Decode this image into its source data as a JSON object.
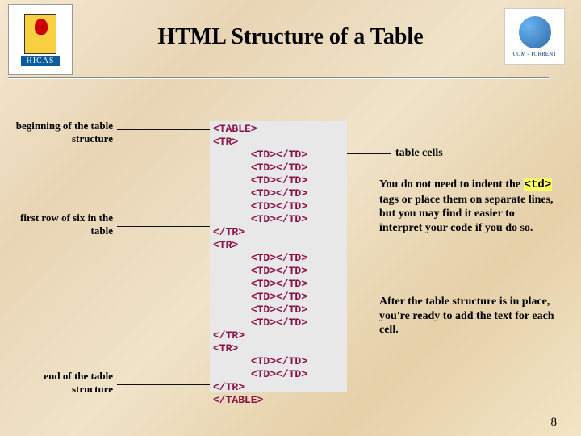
{
  "header": {
    "title": "HTML Structure of a Table",
    "left_logo_text": "HICAS",
    "right_logo_text": "COM - TORRENT"
  },
  "labels": {
    "beginning": "beginning of the table structure",
    "first_row": "first row of six in the table",
    "end": "end of the table structure",
    "cells": "table cells"
  },
  "code": {
    "lines": [
      {
        "t": "<TABLE>",
        "i": 0
      },
      {
        "t": "<TR>",
        "i": 0
      },
      {
        "t": "<TD></TD>",
        "i": 1
      },
      {
        "t": "<TD></TD>",
        "i": 1
      },
      {
        "t": "<TD></TD>",
        "i": 1
      },
      {
        "t": "<TD></TD>",
        "i": 1
      },
      {
        "t": "<TD></TD>",
        "i": 1
      },
      {
        "t": "<TD></TD>",
        "i": 1
      },
      {
        "t": "</TR>",
        "i": 0
      },
      {
        "t": "<TR>",
        "i": 0
      },
      {
        "t": "<TD></TD>",
        "i": 1
      },
      {
        "t": "<TD></TD>",
        "i": 1
      },
      {
        "t": "<TD></TD>",
        "i": 1
      },
      {
        "t": "<TD></TD>",
        "i": 1
      },
      {
        "t": "<TD></TD>",
        "i": 1
      },
      {
        "t": "<TD></TD>",
        "i": 1
      },
      {
        "t": "</TR>",
        "i": 0
      },
      {
        "t": "<TR>",
        "i": 0
      },
      {
        "t": "<TD></TD>",
        "i": 1
      },
      {
        "t": "<TD></TD>",
        "i": 1
      },
      {
        "t": "</TR>",
        "i": 0
      },
      {
        "t": "</TABLE>",
        "i": 0
      }
    ]
  },
  "explain": {
    "p1_a": "You do not need to indent the ",
    "p1_tag": "<td>",
    "p1_b": " tags or place them on separate lines, but you may find it easier to interpret your code if you do so.",
    "p2": "After the table structure is in place, you're ready to add the text for each cell."
  },
  "page_number": "8"
}
